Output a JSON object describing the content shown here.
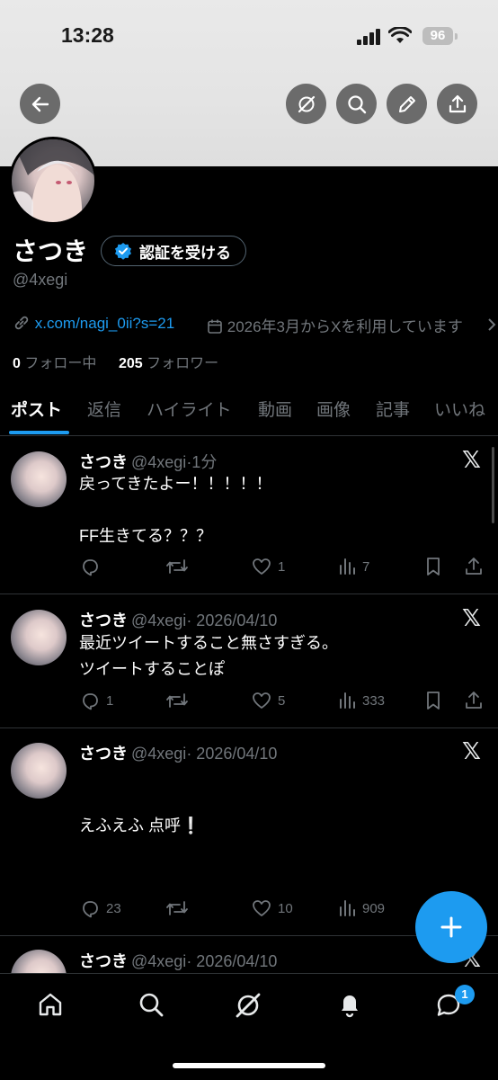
{
  "status_bar": {
    "time": "13:28",
    "battery": "96"
  },
  "profile": {
    "name": "さつき",
    "verify_label": "認証を受ける",
    "handle": "@4xegi",
    "link": "x.com/nagi_0ii?s=21",
    "joined": "2026年3月からXを利用しています",
    "following_count": "0",
    "following_label": "フォロー中",
    "followers_count": "205",
    "followers_label": "フォロワー"
  },
  "tabs": [
    "ポスト",
    "返信",
    "ハイライト",
    "動画",
    "画像",
    "記事",
    "いいね"
  ],
  "posts": [
    {
      "name": "さつき",
      "handle": "@4xegi",
      "time": "·1分",
      "text": "戻ってきたよー！！！！！\n\nFF生きてる？？？",
      "replies": "",
      "reposts": "",
      "likes": "1",
      "views": "7"
    },
    {
      "name": "さつき",
      "handle": "@4xegi",
      "time": "· 2026/04/10",
      "text": "最近ツイートすること無さすぎる。\nツイートすることぽ",
      "replies": "1",
      "reposts": "",
      "likes": "5",
      "views": "333"
    },
    {
      "name": "さつき",
      "handle": "@4xegi",
      "time": "· 2026/04/10",
      "text": "えふえふ 点呼❕",
      "replies": "23",
      "reposts": "",
      "likes": "10",
      "views": "909"
    },
    {
      "name": "さつき",
      "handle": "@4xegi",
      "time": "· 2026/04/10"
    }
  ],
  "notifications_badge": "1",
  "icons": {
    "back": "back-arrow-icon",
    "grok": "grok-icon",
    "search": "search-icon",
    "edit": "pencil-icon",
    "share": "share-icon",
    "reply": "reply-icon",
    "repost": "repost-icon",
    "like": "heart-icon",
    "views": "views-icon",
    "bookmark": "bookmark-icon",
    "home": "home-icon",
    "bell": "bell-icon",
    "messages": "messages-icon",
    "x_logo": "x-logo-icon",
    "compose": "plus-icon"
  },
  "colors": {
    "accent": "#1d9bf0",
    "muted": "#71767b",
    "background": "#000000"
  }
}
